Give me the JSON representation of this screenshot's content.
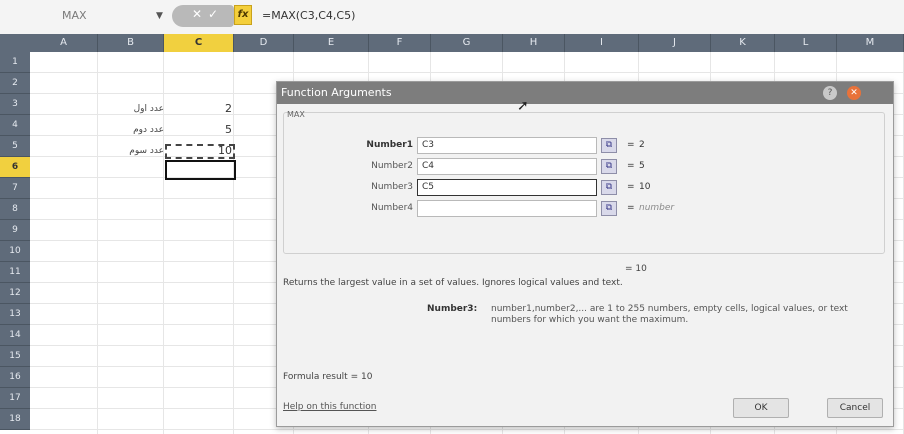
{
  "formula_bar": {
    "name_box": "MAX",
    "cancel_glyph": "✕",
    "enter_glyph": "✓",
    "fx_glyph": "fx",
    "formula": "=MAX(C3,C4,C5)"
  },
  "columns": [
    "A",
    "B",
    "C",
    "D",
    "E",
    "F",
    "G",
    "H",
    "I",
    "J",
    "K",
    "L",
    "M"
  ],
  "rows": [
    "1",
    "2",
    "3",
    "4",
    "5",
    "6",
    "7",
    "8",
    "9",
    "10",
    "11",
    "12",
    "13",
    "14",
    "15",
    "16",
    "17",
    "18"
  ],
  "active_column": "C",
  "active_row": "6",
  "sheet_cells": [
    {
      "label": "عدد اول",
      "value": "2"
    },
    {
      "label": "عدد دوم",
      "value": "5"
    },
    {
      "label": "عدد سوم",
      "value": "10"
    }
  ],
  "dialog": {
    "title": "Function Arguments",
    "help_glyph": "?",
    "close_glyph": "✕",
    "function_name": "MAX",
    "arguments": [
      {
        "label": "Number1",
        "value": "C3",
        "result": "2",
        "eq": "="
      },
      {
        "label": "Number2",
        "value": "C4",
        "result": "5",
        "eq": "="
      },
      {
        "label": "Number3",
        "value": "C5",
        "result": "10",
        "eq": "="
      },
      {
        "label": "Number4",
        "value": "",
        "result": "number",
        "eq": "="
      }
    ],
    "final_result": "= 10",
    "description": "Returns the largest value in a set of values. Ignores logical values and text.",
    "arg_help_name": "Number3:",
    "arg_help_text": "number1,number2,... are 1 to 255 numbers, empty cells, logical values, or text numbers for which you want the maximum.",
    "formula_result": "Formula result = 10",
    "help_link": "Help on this function",
    "ok_label": "OK",
    "cancel_label": "Cancel"
  },
  "colors": {
    "header_bg": "#5f6b7a",
    "active_header": "#f1d03f",
    "titlebar": "#7d7d7d",
    "close_button": "#e8723a"
  }
}
